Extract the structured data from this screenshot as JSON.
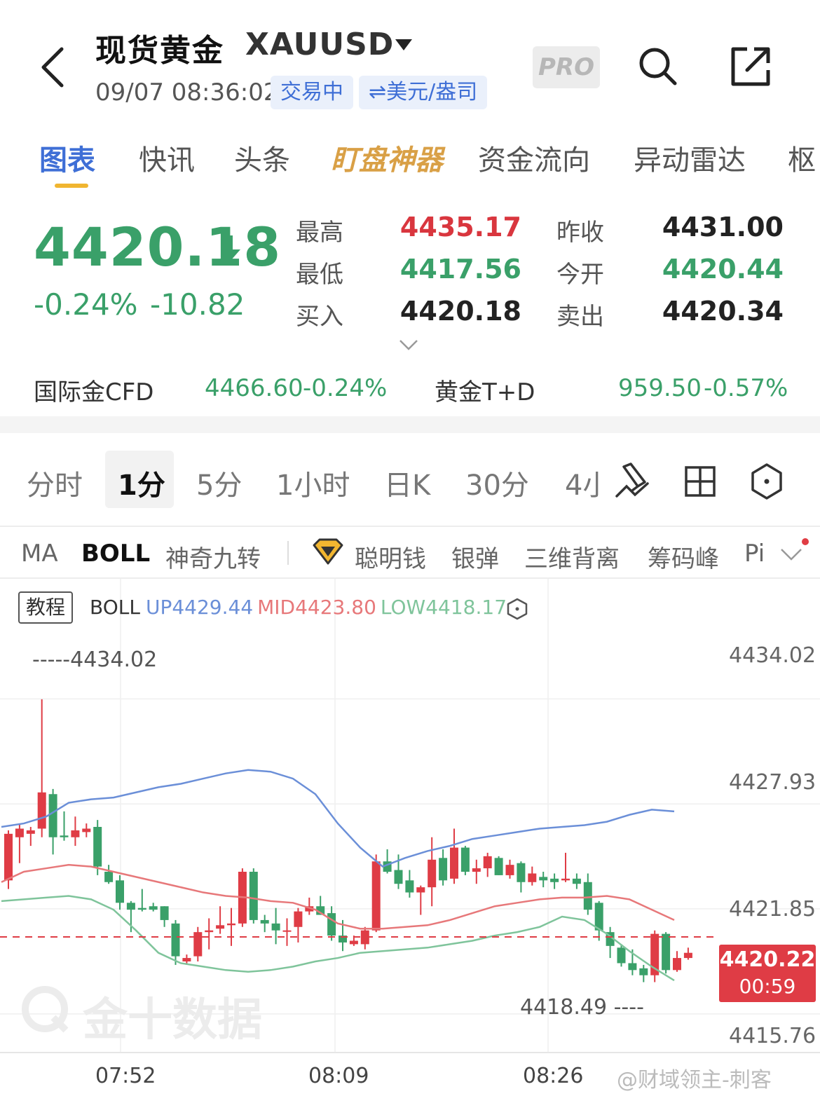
{
  "header": {
    "title": "现货黄金",
    "symbol": "XAUUSD",
    "timestamp": "09/07 08:36:02",
    "status_chip": "交易中",
    "unit_chip": "⇌美元/盎司",
    "pro_label": "PRO"
  },
  "tabs": [
    "图表",
    "快讯",
    "头条",
    "盯盘神器",
    "资金流向",
    "异动雷达",
    "枢"
  ],
  "quote": {
    "price": "4420.18",
    "change_pct": "-0.24%",
    "change_abs": "-10.82",
    "labels": {
      "high": "最高",
      "low": "最低",
      "bid": "买入",
      "prev_close": "昨收",
      "open": "今开",
      "ask": "卖出"
    },
    "values": {
      "high": "4435.17",
      "low": "4417.56",
      "bid": "4420.18",
      "prev_close": "4431.00",
      "open": "4420.44",
      "ask": "4420.34"
    }
  },
  "related": {
    "cfd_label": "国际金CFD",
    "cfd_price": "4466.60",
    "cfd_change": "-0.24%",
    "td_label": "黄金T+D",
    "td_price": "959.50",
    "td_change": "-0.57%"
  },
  "periods": [
    "分时",
    "1分",
    "5分",
    "1小时",
    "日K",
    "30分",
    "4小"
  ],
  "indicators": [
    "MA",
    "BOLL",
    "神奇九转",
    "聪明钱",
    "银弹",
    "三维背离",
    "筹码峰",
    "Pi"
  ],
  "chart": {
    "tutorial_label": "教程",
    "boll_label": "BOLL",
    "boll_up": "UP4429.44",
    "boll_mid": "MID4423.80",
    "boll_low": "LOW4418.17",
    "y_ticks": [
      "4434.02",
      "4427.93",
      "4421.85",
      "4415.76"
    ],
    "x_ticks": [
      "07:52",
      "08:09",
      "08:26"
    ],
    "high_marker": "-----4434.02",
    "low_marker": "4418.49 ----",
    "current_price": "4420.22",
    "countdown": "00:59",
    "watermark": "金十数据",
    "credit": "@财域领主-刺客",
    "colors": {
      "up": "#df3c45",
      "down": "#3aa069",
      "boll_up": "#6b8fd8",
      "boll_mid": "#e7787a",
      "boll_low": "#7fc49b"
    }
  },
  "chart_data": {
    "type": "candlestick",
    "ylim": [
      4413.6,
      4435.7
    ],
    "candles": [
      {
        "o": 4423.5,
        "h": 4426.4,
        "l": 4423.0,
        "c": 4426.2
      },
      {
        "o": 4426.0,
        "h": 4426.8,
        "l": 4424.5,
        "c": 4426.5
      },
      {
        "o": 4426.2,
        "h": 4426.6,
        "l": 4425.5,
        "c": 4426.4
      },
      {
        "o": 4426.5,
        "h": 4434.0,
        "l": 4426.0,
        "c": 4428.6
      },
      {
        "o": 4428.5,
        "h": 4428.8,
        "l": 4425.0,
        "c": 4426.0
      },
      {
        "o": 4426.1,
        "h": 4427.5,
        "l": 4425.8,
        "c": 4426.0
      },
      {
        "o": 4426.0,
        "h": 4427.2,
        "l": 4425.5,
        "c": 4426.4
      },
      {
        "o": 4426.3,
        "h": 4426.8,
        "l": 4426.0,
        "c": 4426.5
      },
      {
        "o": 4426.6,
        "h": 4427.0,
        "l": 4423.8,
        "c": 4424.3
      },
      {
        "o": 4424.0,
        "h": 4424.4,
        "l": 4423.3,
        "c": 4423.4
      },
      {
        "o": 4423.5,
        "h": 4423.8,
        "l": 4421.8,
        "c": 4422.2
      },
      {
        "o": 4422.2,
        "h": 4422.3,
        "l": 4420.5,
        "c": 4421.8
      },
      {
        "o": 4421.9,
        "h": 4423.0,
        "l": 4421.7,
        "c": 4421.8
      },
      {
        "o": 4422.0,
        "h": 4422.2,
        "l": 4421.7,
        "c": 4421.8
      },
      {
        "o": 4422.0,
        "h": 4422.0,
        "l": 4420.8,
        "c": 4421.2
      },
      {
        "o": 4421.0,
        "h": 4421.2,
        "l": 4418.6,
        "c": 4419.1
      },
      {
        "o": 4418.8,
        "h": 4419.2,
        "l": 4418.6,
        "c": 4419.0
      },
      {
        "o": 4419.1,
        "h": 4420.8,
        "l": 4418.8,
        "c": 4420.5
      },
      {
        "o": 4420.5,
        "h": 4421.3,
        "l": 4419.5,
        "c": 4420.6
      },
      {
        "o": 4420.7,
        "h": 4422.0,
        "l": 4420.4,
        "c": 4420.9
      },
      {
        "o": 4420.9,
        "h": 4421.9,
        "l": 4419.7,
        "c": 4421.0
      },
      {
        "o": 4421.0,
        "h": 4424.2,
        "l": 4420.8,
        "c": 4424.0
      },
      {
        "o": 4424.0,
        "h": 4424.2,
        "l": 4421.0,
        "c": 4421.2
      },
      {
        "o": 4421.2,
        "h": 4421.5,
        "l": 4420.5,
        "c": 4421.0
      },
      {
        "o": 4421.0,
        "h": 4421.9,
        "l": 4419.8,
        "c": 4420.6
      },
      {
        "o": 4420.6,
        "h": 4421.3,
        "l": 4419.7,
        "c": 4420.6
      },
      {
        "o": 4420.8,
        "h": 4421.9,
        "l": 4419.9,
        "c": 4421.7
      },
      {
        "o": 4421.7,
        "h": 4422.5,
        "l": 4421.5,
        "c": 4422.0
      },
      {
        "o": 4422.0,
        "h": 4422.6,
        "l": 4421.5,
        "c": 4421.5
      },
      {
        "o": 4421.6,
        "h": 4422.0,
        "l": 4420.0,
        "c": 4420.3
      },
      {
        "o": 4420.3,
        "h": 4421.2,
        "l": 4419.4,
        "c": 4419.9
      },
      {
        "o": 4419.8,
        "h": 4420.3,
        "l": 4419.7,
        "c": 4420.0
      },
      {
        "o": 4419.8,
        "h": 4420.8,
        "l": 4419.5,
        "c": 4420.6
      },
      {
        "o": 4420.6,
        "h": 4425.0,
        "l": 4420.5,
        "c": 4424.6
      },
      {
        "o": 4424.6,
        "h": 4425.3,
        "l": 4423.9,
        "c": 4424.0
      },
      {
        "o": 4424.1,
        "h": 4425.0,
        "l": 4423.0,
        "c": 4423.3
      },
      {
        "o": 4423.5,
        "h": 4424.1,
        "l": 4422.5,
        "c": 4422.8
      },
      {
        "o": 4422.8,
        "h": 4423.2,
        "l": 4421.5,
        "c": 4423.1
      },
      {
        "o": 4423.1,
        "h": 4426.0,
        "l": 4422.0,
        "c": 4424.7
      },
      {
        "o": 4424.8,
        "h": 4425.3,
        "l": 4423.2,
        "c": 4423.5
      },
      {
        "o": 4423.6,
        "h": 4426.5,
        "l": 4423.3,
        "c": 4425.4
      },
      {
        "o": 4425.4,
        "h": 4425.5,
        "l": 4423.8,
        "c": 4424.0
      },
      {
        "o": 4424.0,
        "h": 4424.7,
        "l": 4423.3,
        "c": 4424.2
      },
      {
        "o": 4424.2,
        "h": 4425.1,
        "l": 4423.7,
        "c": 4424.9
      },
      {
        "o": 4424.8,
        "h": 4424.9,
        "l": 4423.8,
        "c": 4423.8
      },
      {
        "o": 4423.8,
        "h": 4424.7,
        "l": 4423.6,
        "c": 4424.4
      },
      {
        "o": 4424.5,
        "h": 4424.6,
        "l": 4422.8,
        "c": 4423.4
      },
      {
        "o": 4423.4,
        "h": 4424.3,
        "l": 4423.2,
        "c": 4423.9
      },
      {
        "o": 4423.7,
        "h": 4424.0,
        "l": 4423.1,
        "c": 4423.5
      },
      {
        "o": 4423.6,
        "h": 4423.9,
        "l": 4423.0,
        "c": 4423.4
      },
      {
        "o": 4423.5,
        "h": 4425.1,
        "l": 4423.4,
        "c": 4423.6
      },
      {
        "o": 4423.6,
        "h": 4423.9,
        "l": 4423.0,
        "c": 4423.3
      },
      {
        "o": 4423.4,
        "h": 4423.9,
        "l": 4421.5,
        "c": 4421.8
      },
      {
        "o": 4422.2,
        "h": 4422.3,
        "l": 4420.0,
        "c": 4420.6
      },
      {
        "o": 4420.5,
        "h": 4420.8,
        "l": 4419.0,
        "c": 4419.7
      },
      {
        "o": 4419.6,
        "h": 4419.8,
        "l": 4418.5,
        "c": 4418.7
      },
      {
        "o": 4418.7,
        "h": 4419.5,
        "l": 4418.0,
        "c": 4418.3
      },
      {
        "o": 4418.4,
        "h": 4418.6,
        "l": 4417.6,
        "c": 4418.0
      },
      {
        "o": 4418.0,
        "h": 4420.6,
        "l": 4417.6,
        "c": 4420.4
      },
      {
        "o": 4420.4,
        "h": 4420.5,
        "l": 4418.1,
        "c": 4418.3
      },
      {
        "o": 4418.3,
        "h": 4419.4,
        "l": 4418.2,
        "c": 4419.0
      },
      {
        "o": 4419.0,
        "h": 4419.6,
        "l": 4418.9,
        "c": 4419.3
      }
    ],
    "boll_up": [
      4426.6,
      4426.8,
      4427.2,
      4428.0,
      4428.2,
      4428.3,
      4428.6,
      4428.9,
      4429.1,
      4429.4,
      4429.7,
      4429.9,
      4429.8,
      4429.4,
      4428.5,
      4426.8,
      4425.4,
      4424.3,
      4424.8,
      4425.2,
      4425.5,
      4425.9,
      4426.1,
      4426.3,
      4426.5,
      4426.6,
      4426.7,
      4426.9,
      4427.3,
      4427.6,
      4427.5
    ],
    "boll_mid": [
      4423.4,
      4424.0,
      4424.2,
      4424.4,
      4424.3,
      4424.0,
      4423.7,
      4423.4,
      4423.1,
      4422.8,
      4422.6,
      4422.5,
      4422.3,
      4422.2,
      4421.8,
      4421.0,
      4420.7,
      4420.7,
      4420.8,
      4420.9,
      4421.2,
      4421.6,
      4422.0,
      4422.2,
      4422.4,
      4422.5,
      4422.5,
      4422.6,
      4422.4,
      4421.8,
      4421.2
    ],
    "boll_low": [
      4422.3,
      4422.4,
      4422.5,
      4422.6,
      4422.4,
      4421.8,
      4420.6,
      4419.3,
      4418.7,
      4418.5,
      4418.3,
      4418.2,
      4418.3,
      4418.5,
      4418.8,
      4419.0,
      4419.3,
      4419.4,
      4419.5,
      4419.6,
      4419.8,
      4420.0,
      4420.3,
      4420.5,
      4420.8,
      4421.4,
      4421.2,
      4420.4,
      4419.4,
      4418.5,
      4417.7
    ],
    "y_ticks": [
      4434.02,
      4427.93,
      4421.85,
      4415.76
    ],
    "x_ticks": [
      "07:52",
      "08:09",
      "08:26"
    ],
    "current": 4420.22,
    "high_marker": 4434.02,
    "low_marker": 4418.49
  }
}
